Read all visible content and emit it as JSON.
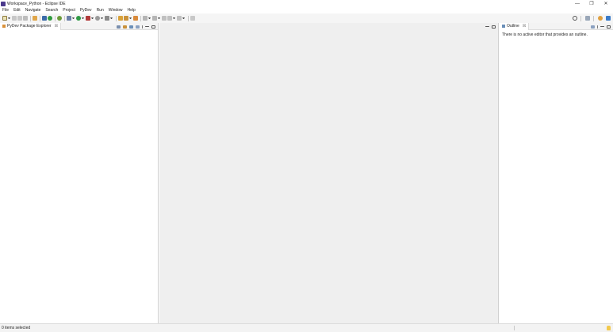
{
  "window": {
    "title": "Workspace_Python - Eclipse IDE",
    "buttons": {
      "minimize": "—",
      "restore": "❐",
      "close": "✕"
    }
  },
  "menu": [
    "File",
    "Edit",
    "Navigate",
    "Search",
    "Project",
    "PyDev",
    "Run",
    "Window",
    "Help"
  ],
  "toolbar": {
    "icons": [
      "new-icon",
      "save-icon",
      "save-all-icon",
      "print-icon",
      "pydev-new-project-icon",
      "console-icon",
      "python-icon",
      "debug-icon",
      "run-icon",
      "coverage-icon",
      "external-tools-icon",
      "open-type-icon",
      "open-task-icon",
      "annotation-next-icon",
      "annotation-prev-icon",
      "back-icon",
      "forward-icon",
      "pin-editor-icon"
    ],
    "right_icons": [
      "search-icon",
      "open-perspective-icon",
      "pydev-perspective-icon",
      "java-perspective-icon"
    ]
  },
  "left_panel": {
    "tab_label": "PyDev Package Explorer",
    "tab_close": "☒"
  },
  "right_panel": {
    "tab_label": "Outline",
    "tab_close": "☒",
    "message": "There is no active editor that provides an outline."
  },
  "status": {
    "text": "0 items selected"
  },
  "colors": {
    "toolbar_bg": "#f5f5f5",
    "editor_bg": "#efefef",
    "panel_header_bg": "#f3f3f3",
    "accent": "#4b3a8c"
  }
}
